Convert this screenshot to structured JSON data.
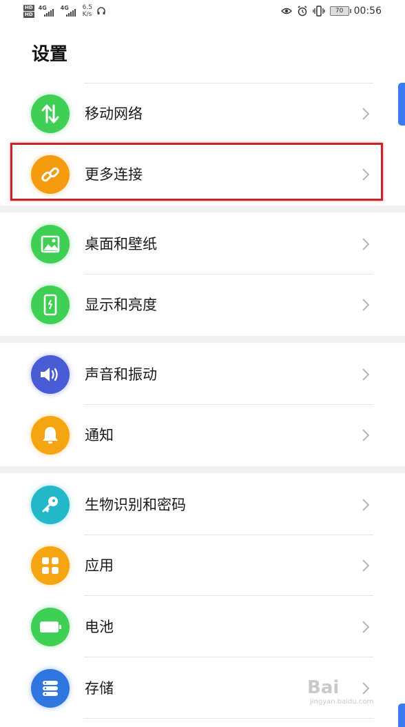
{
  "status_bar": {
    "hd1": "HD",
    "hd2": "HD",
    "net1": "4G",
    "net2": "4G",
    "speed_value": "6.5",
    "speed_unit": "K/s",
    "battery": "70",
    "time": "00:56"
  },
  "page": {
    "title": "设置"
  },
  "settings_items": [
    {
      "label": "移动网络",
      "icon": "updown-arrows-icon",
      "color": "#3fcf55"
    },
    {
      "label": "更多连接",
      "icon": "link-icon",
      "color": "#f59b10"
    },
    {
      "label": "桌面和壁纸",
      "icon": "image-icon",
      "color": "#3fcf55"
    },
    {
      "label": "显示和亮度",
      "icon": "phone-brightness-icon",
      "color": "#3fcf55"
    },
    {
      "label": "声音和振动",
      "icon": "speaker-icon",
      "color": "#4a5bd6"
    },
    {
      "label": "通知",
      "icon": "bell-icon",
      "color": "#f5a412"
    },
    {
      "label": "生物识别和密码",
      "icon": "key-icon",
      "color": "#22b8c8"
    },
    {
      "label": "应用",
      "icon": "apps-grid-icon",
      "color": "#f5a412"
    },
    {
      "label": "电池",
      "icon": "battery-icon",
      "color": "#3fcf55"
    },
    {
      "label": "存储",
      "icon": "storage-icon",
      "color": "#2f76e0"
    }
  ],
  "watermark": {
    "main": "Bai",
    "sub": "jingyan.baidu.com"
  }
}
